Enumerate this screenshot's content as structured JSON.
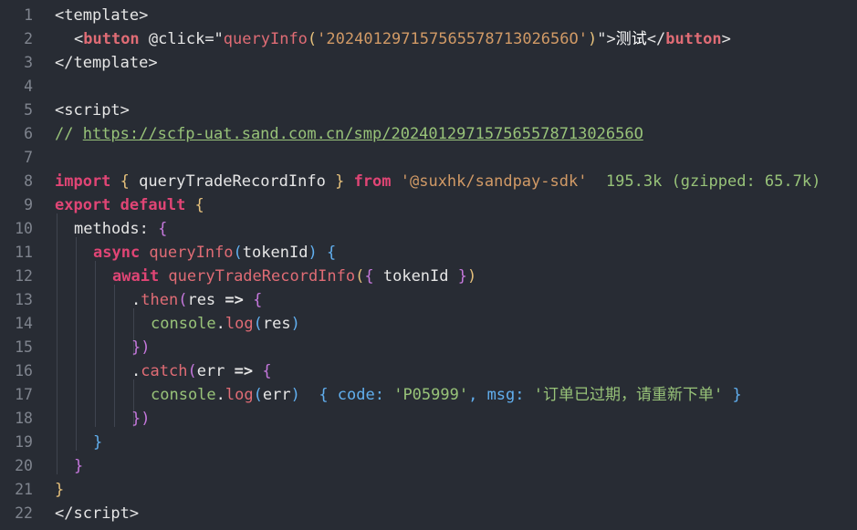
{
  "editor": {
    "line_numbers": [
      "1",
      "2",
      "3",
      "4",
      "5",
      "6",
      "7",
      "8",
      "9",
      "10",
      "11",
      "12",
      "13",
      "14",
      "15",
      "16",
      "17",
      "18",
      "19",
      "20",
      "21",
      "22"
    ],
    "l1": {
      "open": "<",
      "tag": "template",
      "close": ">"
    },
    "l2": {
      "open": "<",
      "tag": "button",
      "attr": " @click=\"",
      "fn": "queryInfo",
      "p1": "(",
      "str": "'20240129715756557871302656O'",
      "p2": ")",
      "q": "\">",
      "text": "测试",
      "closeopen": "</",
      "closetag": "button",
      "closeend": ">"
    },
    "l3": {
      "open": "</",
      "tag": "template",
      "close": ">"
    },
    "l5": {
      "open": "<",
      "tag": "script",
      "close": ">"
    },
    "l6": {
      "slashes": "// ",
      "url": "https://scfp-uat.sand.com.cn/smp/20240129715756557871302656O"
    },
    "l8": {
      "kw": "import",
      "b1": " { ",
      "name": "queryTradeRecordInfo",
      "b2": " } ",
      "from": "from",
      "mod": " '@suxhk/sandpay-sdk'",
      "size": "  195.3k (gzipped: 65.7k)"
    },
    "l9": {
      "kw1": "export",
      "kw2": " default",
      "b": " {"
    },
    "l10": {
      "name": "methods",
      "colon": ": ",
      "b": "{"
    },
    "l11": {
      "kw": "async",
      "fn": " queryInfo",
      "p1": "(",
      "arg": "tokenId",
      "p2": ")",
      "b": " {"
    },
    "l12": {
      "kw": "await",
      "fn": " queryTradeRecordInfo",
      "p1": "(",
      "b1": "{ ",
      "arg": "tokenId",
      "b2": " }",
      "p2": ")"
    },
    "l13": {
      "dot": ".",
      "fn": "then",
      "p1": "(",
      "arg": "res",
      "arrow": " => ",
      "b": "{"
    },
    "l14": {
      "obj": "console",
      "dot": ".",
      "fn": "log",
      "p1": "(",
      "arg": "res",
      "p2": ")"
    },
    "l15": {
      "b": "}",
      "p": ")"
    },
    "l16": {
      "dot": ".",
      "fn": "catch",
      "p1": "(",
      "arg": "err",
      "arrow": " => ",
      "b": "{"
    },
    "l17": {
      "obj": "console",
      "dot": ".",
      "fn": "log",
      "p1": "(",
      "arg": "err",
      "p2": ")",
      "ann": "  { code: ",
      "code": "'P05999'",
      "ann2": ", msg: ",
      "msg": "'订单已过期，请重新下单'",
      "ann3": " }"
    },
    "l18": {
      "b": "}",
      "p": ")"
    },
    "l19": {
      "b": "}"
    },
    "l20": {
      "b": "}"
    },
    "l21": {
      "b": "}"
    },
    "l22": {
      "open": "</",
      "tag": "script",
      "close": ">"
    }
  }
}
